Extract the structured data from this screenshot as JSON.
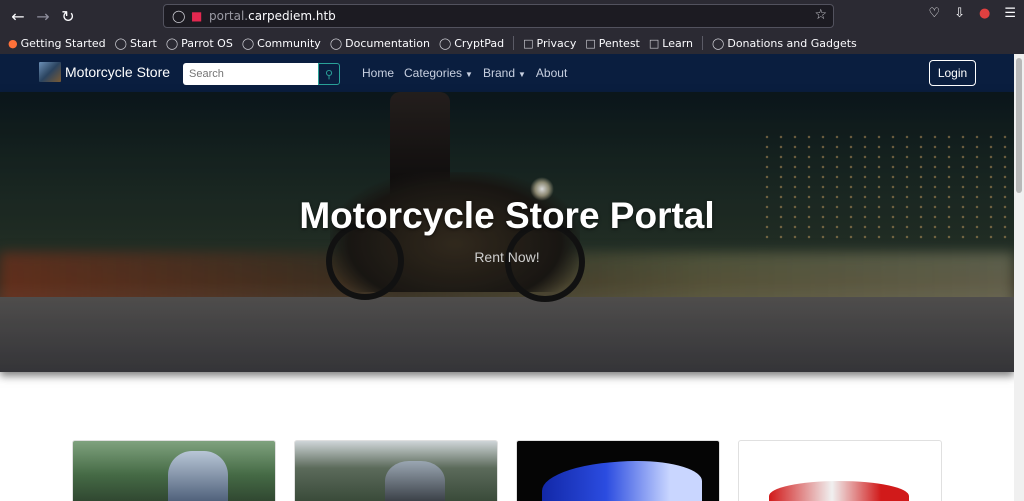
{
  "browser": {
    "url_domain": "portal.",
    "url_rest": "carpediem.htb",
    "bookmarks": [
      {
        "label": "Getting Started",
        "icon": "firefox-icon"
      },
      {
        "label": "Start",
        "icon": "globe-icon"
      },
      {
        "label": "Parrot OS",
        "icon": "globe-icon"
      },
      {
        "label": "Community",
        "icon": "globe-icon"
      },
      {
        "label": "Documentation",
        "icon": "globe-icon"
      },
      {
        "label": "CryptPad",
        "icon": "globe-icon"
      },
      {
        "label": "Privacy",
        "icon": "folder-icon"
      },
      {
        "label": "Pentest",
        "icon": "folder-icon"
      },
      {
        "label": "Learn",
        "icon": "folder-icon"
      },
      {
        "label": "Donations and Gadgets",
        "icon": "globe-icon"
      }
    ]
  },
  "site": {
    "brand": "Motorcycle Store",
    "search_placeholder": "Search",
    "nav": {
      "home": "Home",
      "categories": "Categories",
      "brand": "Brand",
      "about": "About"
    },
    "login": "Login"
  },
  "hero": {
    "title": "Motorcycle Store Portal",
    "subtitle": "Rent Now!"
  },
  "colors": {
    "navbar": "#0a1e3f",
    "browser_chrome": "#2b2a33"
  }
}
